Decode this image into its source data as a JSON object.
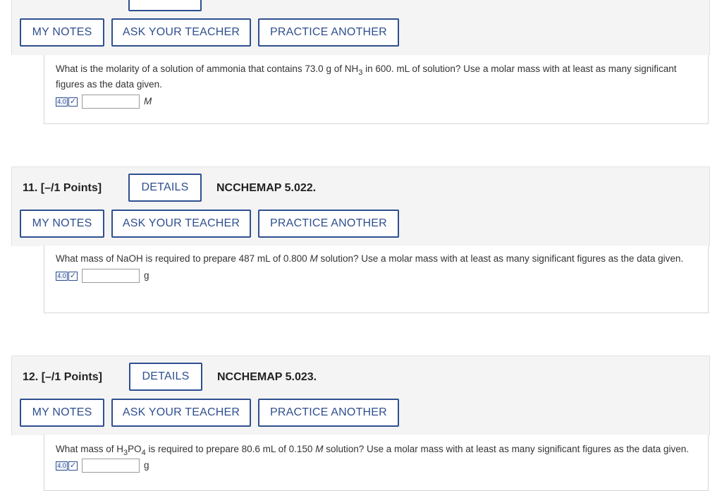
{
  "q10": {
    "buttons": {
      "notes": "MY NOTES",
      "ask": "ASK YOUR TEACHER",
      "practice": "PRACTICE ANOTHER"
    },
    "text_a": "What is the molarity of a solution of ammonia that contains 73.0 g of NH",
    "sub_a": "3",
    "text_b": " in 600. mL of solution? Use a molar mass with at least as many significant figures as the data given.",
    "answer_value": "",
    "unit": "M",
    "sigfig_badge": "4.0"
  },
  "q11": {
    "label": "11.  [–/1 Points]",
    "details": "DETAILS",
    "code": "NCCHEMAP 5.022.",
    "buttons": {
      "notes": "MY NOTES",
      "ask": "ASK YOUR TEACHER",
      "practice": "PRACTICE ANOTHER"
    },
    "text_a": "What mass of NaOH is required to prepare 487 mL of 0.800 ",
    "italic": "M",
    "text_b": " solution? Use a molar mass with at least as many significant figures as the data given.",
    "answer_value": "",
    "unit": "g",
    "sigfig_badge": "4.0"
  },
  "q12": {
    "label": "12.  [–/1 Points]",
    "details": "DETAILS",
    "code": "NCCHEMAP 5.023.",
    "buttons": {
      "notes": "MY NOTES",
      "ask": "ASK YOUR TEACHER",
      "practice": "PRACTICE ANOTHER"
    },
    "text_a": "What mass of H",
    "sub_a": "3",
    "text_mid": "PO",
    "sub_b": "4",
    "text_b": " is required to prepare 80.6 mL of 0.150 ",
    "italic": "M",
    "text_c": " solution? Use a molar mass with at least as many significant figures as the data given.",
    "answer_value": "",
    "unit": "g",
    "sigfig_badge": "4.0"
  },
  "icons": {
    "check": "checkmark-icon"
  }
}
